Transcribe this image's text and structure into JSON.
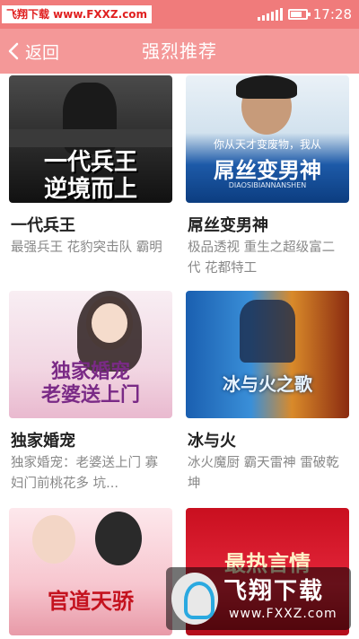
{
  "status_bar": {
    "watermark": "飞翔下载 www.FXXZ.com",
    "time": "17:28",
    "icons": [
      "signal-icon",
      "battery-icon"
    ]
  },
  "header": {
    "back_label": "返回",
    "title": "强烈推荐"
  },
  "books": [
    {
      "name": "一代兵王",
      "desc": "最强兵王 花豹突击队 霸明",
      "cover_text": "一代兵王\n逆境而上"
    },
    {
      "name": "屌丝变男神",
      "desc": "极品透视 重生之超级富二代 花都特工",
      "cover_caption": "你从天才变废物，我从",
      "cover_title": "屌丝变男神",
      "cover_sub": "DIAOSIBIANNANSHEN"
    },
    {
      "name": "独家婚宠",
      "desc": "独家婚宠：老婆送上门 寡妇门前桃花多 坑...",
      "cover_text": "独家婚宠\n老婆送上门"
    },
    {
      "name": "冰与火",
      "desc": "冰火魔厨 霸天雷神 雷破乾坤",
      "cover_text": "冰与火之歌"
    },
    {
      "name": "",
      "desc": "",
      "cover_text": "官道天骄"
    },
    {
      "name": "",
      "desc": "",
      "cover_text": "最热言情"
    }
  ],
  "watermark": {
    "name": "飞翔下载",
    "url": "www.FXXZ.com"
  }
}
